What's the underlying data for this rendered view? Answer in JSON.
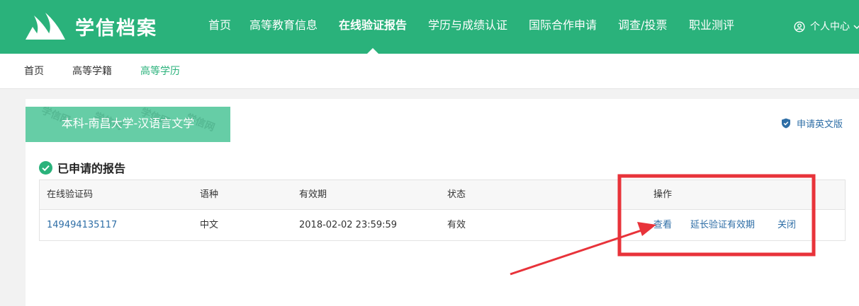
{
  "colors": {
    "brand_green": "#2ab27b",
    "banner_green": "#66cda6",
    "link_blue": "#2e6ea6",
    "annotation_red": "#e8333a"
  },
  "header": {
    "logo_text": "学信档案",
    "nav": [
      {
        "label": "首页"
      },
      {
        "label": "高等教育信息"
      },
      {
        "label": "在线验证报告",
        "active": true
      },
      {
        "label": "学历与成绩认证"
      },
      {
        "label": "国际合作申请"
      },
      {
        "label": "调查/投票"
      },
      {
        "label": "职业测评"
      }
    ],
    "user_center": {
      "label": "个人中心",
      "icon": "user-circle-icon"
    }
  },
  "subnav": {
    "items": [
      {
        "label": "首页"
      },
      {
        "label": "高等学籍"
      },
      {
        "label": "高等学历",
        "active": true
      }
    ]
  },
  "card": {
    "degree_label": "本科-南昌大学-汉语言文学",
    "watermark_text": "学信网",
    "apply_english": {
      "label": "申请英文版",
      "icon": "shield-check-icon"
    },
    "section_title": "已申请的报告",
    "table": {
      "headers": [
        "在线验证码",
        "语种",
        "有效期",
        "状态",
        "操作"
      ],
      "rows": [
        {
          "code": "149494135117",
          "language": "中文",
          "validity": "2018-02-02 23:59:59",
          "status": "有效",
          "actions": {
            "view": "查看",
            "extend": "延长验证有效期",
            "close": "关闭"
          }
        }
      ]
    }
  }
}
